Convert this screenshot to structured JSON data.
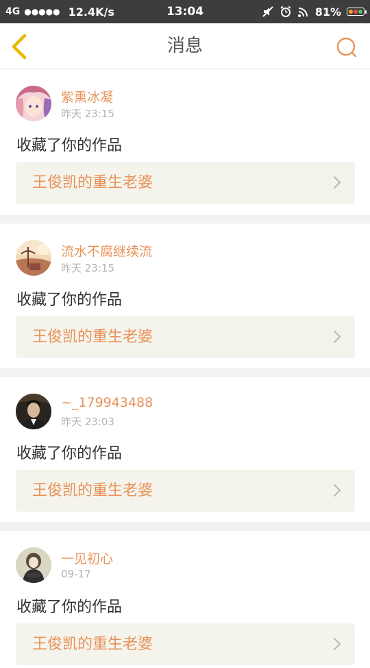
{
  "status_bar": {
    "network": "4G",
    "signal": "●●●●●",
    "speed": "12.4K/s",
    "time": "13:04",
    "battery": "81%"
  },
  "header": {
    "title": "消息"
  },
  "messages": [
    {
      "user": "紫熏冰凝",
      "time": "昨天 23:15",
      "action": "收藏了你的作品",
      "work": "王俊凯的重生老婆"
    },
    {
      "user": "流水不腐继续流",
      "time": "昨天 23:15",
      "action": "收藏了你的作品",
      "work": "王俊凯的重生老婆"
    },
    {
      "user": "~_179943488",
      "time": "昨天 23:03",
      "action": "收藏了你的作品",
      "work": "王俊凯的重生老婆"
    },
    {
      "user": "一见初心",
      "time": "09-17",
      "action": "收藏了你的作品",
      "work": "王俊凯的重生老婆"
    }
  ],
  "colors": {
    "accent": "#e8925a",
    "back_icon": "#e6b800",
    "card_link_bg": "#f4f4ec",
    "status_bar_bg": "#3d3d3d"
  },
  "icons": {
    "back": "chevron-left-icon",
    "search": "search-icon",
    "link": "chevron-right-icon"
  }
}
